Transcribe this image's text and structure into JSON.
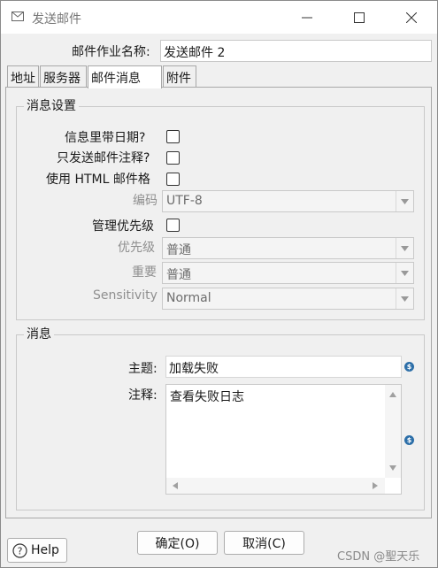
{
  "window": {
    "title": "发送邮件",
    "icon": "envelope-icon",
    "controls": {
      "minimize": "minimize-icon",
      "maximize": "maximize-icon",
      "close": "close-icon"
    }
  },
  "job_name": {
    "label": "邮件作业名称:",
    "value": "发送邮件 2"
  },
  "tabs": [
    {
      "label": "地址",
      "active": false
    },
    {
      "label": "服务器",
      "active": false
    },
    {
      "label": "邮件消息",
      "active": true
    },
    {
      "label": "附件",
      "active": false
    }
  ],
  "message_settings": {
    "title": "消息设置",
    "include_date": {
      "label": "信息里带日期?",
      "checked": false
    },
    "only_comment": {
      "label": "只发送邮件注释?",
      "checked": false
    },
    "use_html": {
      "label": "使用 HTML 邮件格",
      "checked": false
    },
    "encoding": {
      "label": "编码",
      "value": "UTF-8"
    },
    "manage_priority": {
      "label": "管理优先级",
      "checked": false
    },
    "priority": {
      "label": "优先级",
      "value": "普通"
    },
    "importance": {
      "label": "重要",
      "value": "普通"
    },
    "sensitivity": {
      "label": "Sensitivity",
      "value": "Normal"
    }
  },
  "message": {
    "title": "消息",
    "subject": {
      "label": "主题:",
      "value": "加载失败"
    },
    "comment": {
      "label": "注释:",
      "value": "查看失败日志"
    }
  },
  "footer": {
    "help_label": "Help",
    "ok_label": "确定(O)",
    "cancel_label": "取消(C)",
    "watermark": "CSDN @聖天乐"
  }
}
